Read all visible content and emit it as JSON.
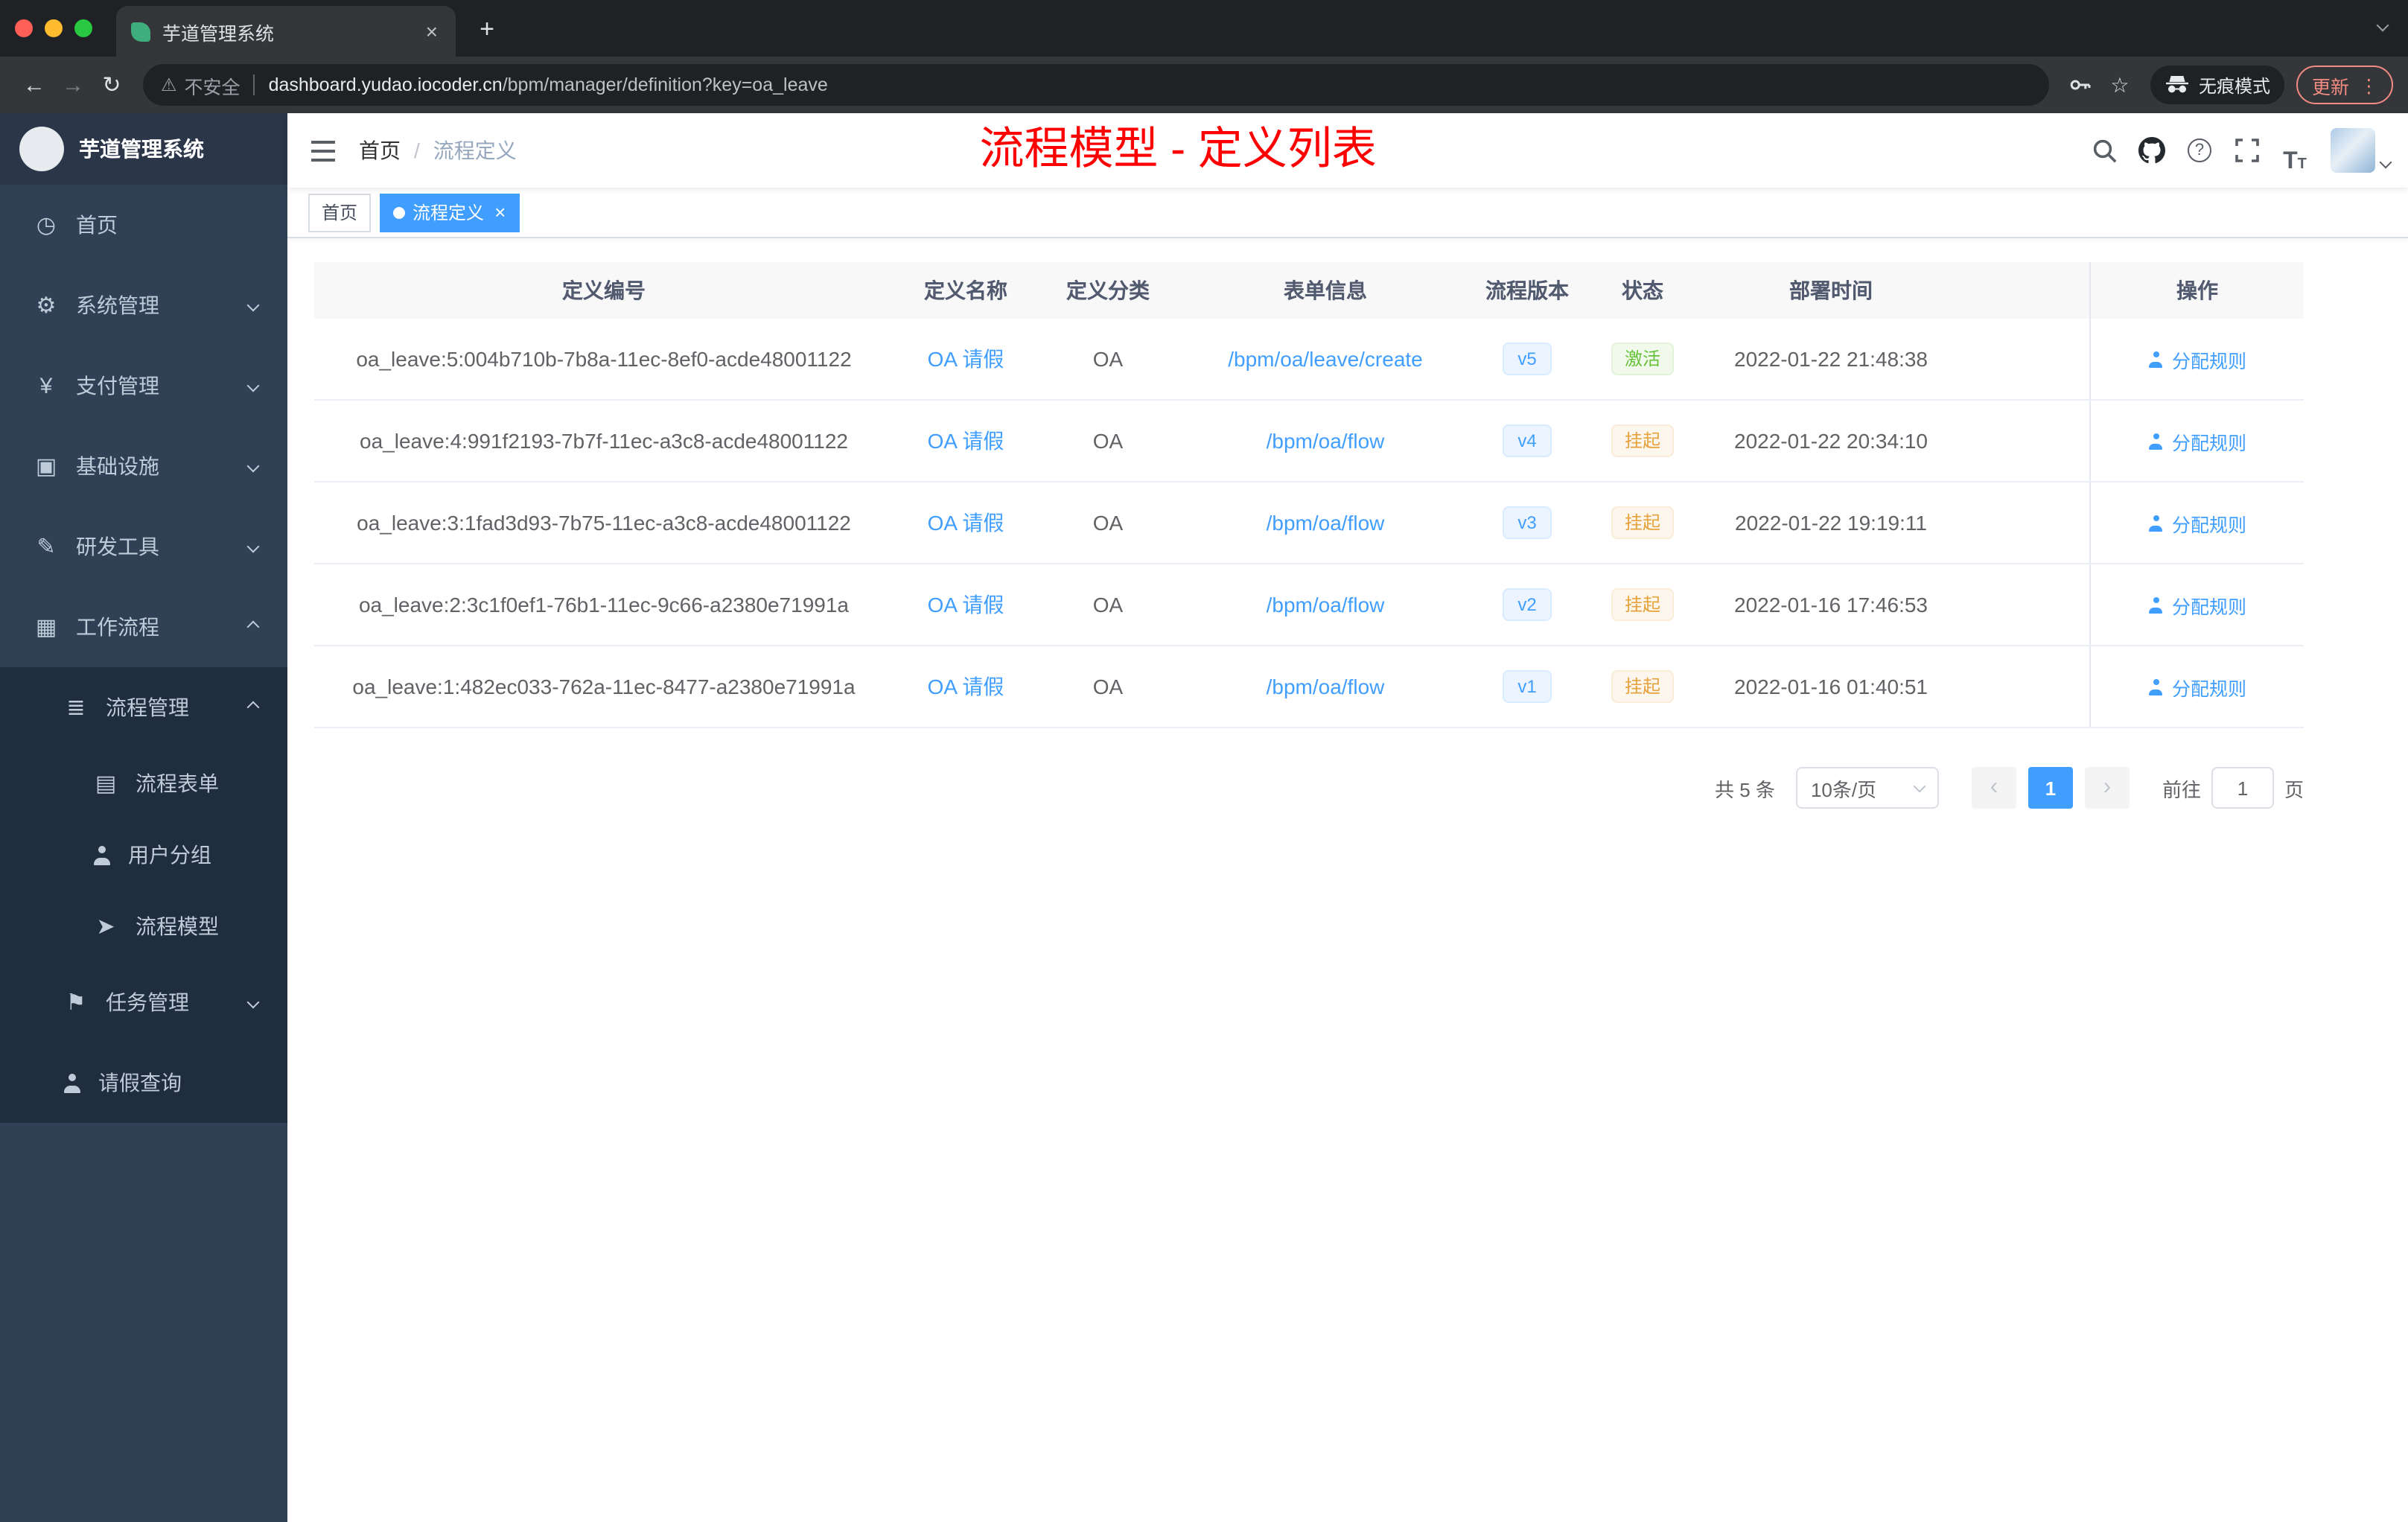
{
  "browser": {
    "tab_title": "芋道管理系统",
    "security_label": "不安全",
    "url_host": "dashboard.yudao.iocoder.cn",
    "url_path": "/bpm/manager/definition?key=oa_leave",
    "incognito_label": "无痕模式",
    "update_label": "更新"
  },
  "icons": {
    "back": "←",
    "forward": "→",
    "reload": "↻",
    "warning": "⚠",
    "star": "☆",
    "dots": "⋮",
    "new_tab": "+",
    "close_tab": "×",
    "question": "?",
    "font_size_large": "T",
    "font_size_small": "T",
    "sidebar_home": "◷",
    "sidebar_system": "⚙",
    "sidebar_payment": "¥",
    "sidebar_infra": "▣",
    "sidebar_devtools": "✎",
    "sidebar_workflow": "▦",
    "sidebar_process_mgmt": "≣",
    "sidebar_process_form": "▤",
    "sidebar_process_model": "➤",
    "sidebar_task": "⚑"
  },
  "sidebar": {
    "logo_title": "芋道管理系统",
    "items": [
      {
        "label": "首页"
      },
      {
        "label": "系统管理"
      },
      {
        "label": "支付管理"
      },
      {
        "label": "基础设施"
      },
      {
        "label": "研发工具"
      },
      {
        "label": "工作流程"
      },
      {
        "label": "流程管理"
      },
      {
        "label": "流程表单"
      },
      {
        "label": "用户分组"
      },
      {
        "label": "流程模型"
      },
      {
        "label": "任务管理"
      },
      {
        "label": "请假查询"
      }
    ]
  },
  "navbar": {
    "breadcrumb_home": "首页",
    "breadcrumb_sep": "/",
    "breadcrumb_current": "流程定义",
    "annotation": "流程模型 - 定义列表"
  },
  "tags": {
    "home": "首页",
    "active": "流程定义"
  },
  "table": {
    "columns": [
      "定义编号",
      "定义名称",
      "定义分类",
      "表单信息",
      "流程版本",
      "状态",
      "部署时间",
      "操作"
    ],
    "rows": [
      {
        "id": "oa_leave:5:004b710b-7b8a-11ec-8ef0-acde48001122",
        "name": "OA 请假",
        "category": "OA",
        "form": "/bpm/oa/leave/create",
        "version": "v5",
        "status": "激活",
        "time": "2022-01-22 21:48:38",
        "action": "分配规则"
      },
      {
        "id": "oa_leave:4:991f2193-7b7f-11ec-a3c8-acde48001122",
        "name": "OA 请假",
        "category": "OA",
        "form": "/bpm/oa/flow",
        "version": "v4",
        "status": "挂起",
        "time": "2022-01-22 20:34:10",
        "action": "分配规则"
      },
      {
        "id": "oa_leave:3:1fad3d93-7b75-11ec-a3c8-acde48001122",
        "name": "OA 请假",
        "category": "OA",
        "form": "/bpm/oa/flow",
        "version": "v3",
        "status": "挂起",
        "time": "2022-01-22 19:19:11",
        "action": "分配规则"
      },
      {
        "id": "oa_leave:2:3c1f0ef1-76b1-11ec-9c66-a2380e71991a",
        "name": "OA 请假",
        "category": "OA",
        "form": "/bpm/oa/flow",
        "version": "v2",
        "status": "挂起",
        "time": "2022-01-16 17:46:53",
        "action": "分配规则"
      },
      {
        "id": "oa_leave:1:482ec033-762a-11ec-8477-a2380e71991a",
        "name": "OA 请假",
        "category": "OA",
        "form": "/bpm/oa/flow",
        "version": "v1",
        "status": "挂起",
        "time": "2022-01-16 01:40:51",
        "action": "分配规则"
      }
    ]
  },
  "pagination": {
    "total": "共 5 条",
    "page_size": "10条/页",
    "prev": "‹",
    "next": "›",
    "current_page": "1",
    "goto_label": "前往",
    "goto_value": "1",
    "goto_unit": "页"
  },
  "colors": {
    "accent": "#409eff",
    "success": "#67c23a",
    "warning": "#e6a23c",
    "annotation_red": "#fe0000",
    "sidebar_bg": "#304156",
    "submenu_bg": "#1f2d3d"
  }
}
